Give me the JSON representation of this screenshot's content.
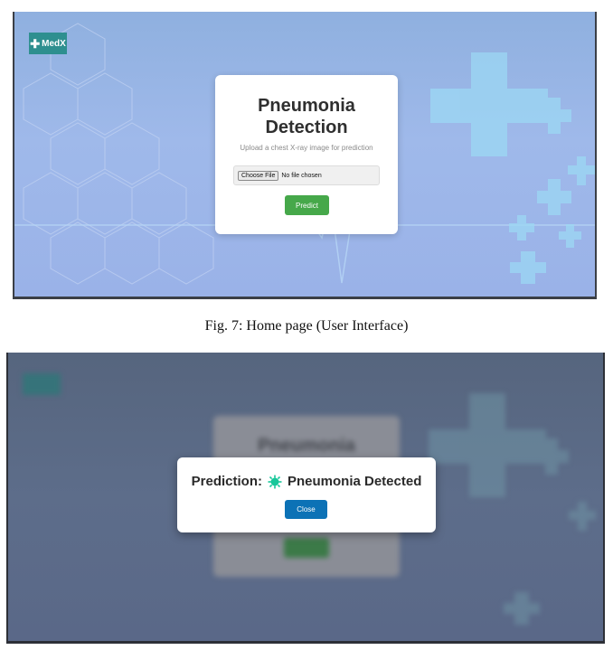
{
  "home": {
    "logo": {
      "icon": "plus-icon",
      "text": "MedX"
    },
    "card": {
      "title": "Pneumonia Detection",
      "subtitle": "Upload a chest X-ray image for prediction",
      "file_button_label": "Choose File",
      "file_status": "No file chosen",
      "predict_label": "Predict"
    }
  },
  "caption": "Fig. 7: Home page (User Interface)",
  "result": {
    "background_title": "Pneumonia",
    "prediction_label": "Prediction:",
    "prediction_icon": "virus-icon",
    "prediction_value": "Pneumonia Detected",
    "close_label": "Close"
  },
  "colors": {
    "logo": "#2e8f8f",
    "predict_button": "#46a84a",
    "close_button": "#0c72b6",
    "virus_icon": "#17c79a"
  }
}
